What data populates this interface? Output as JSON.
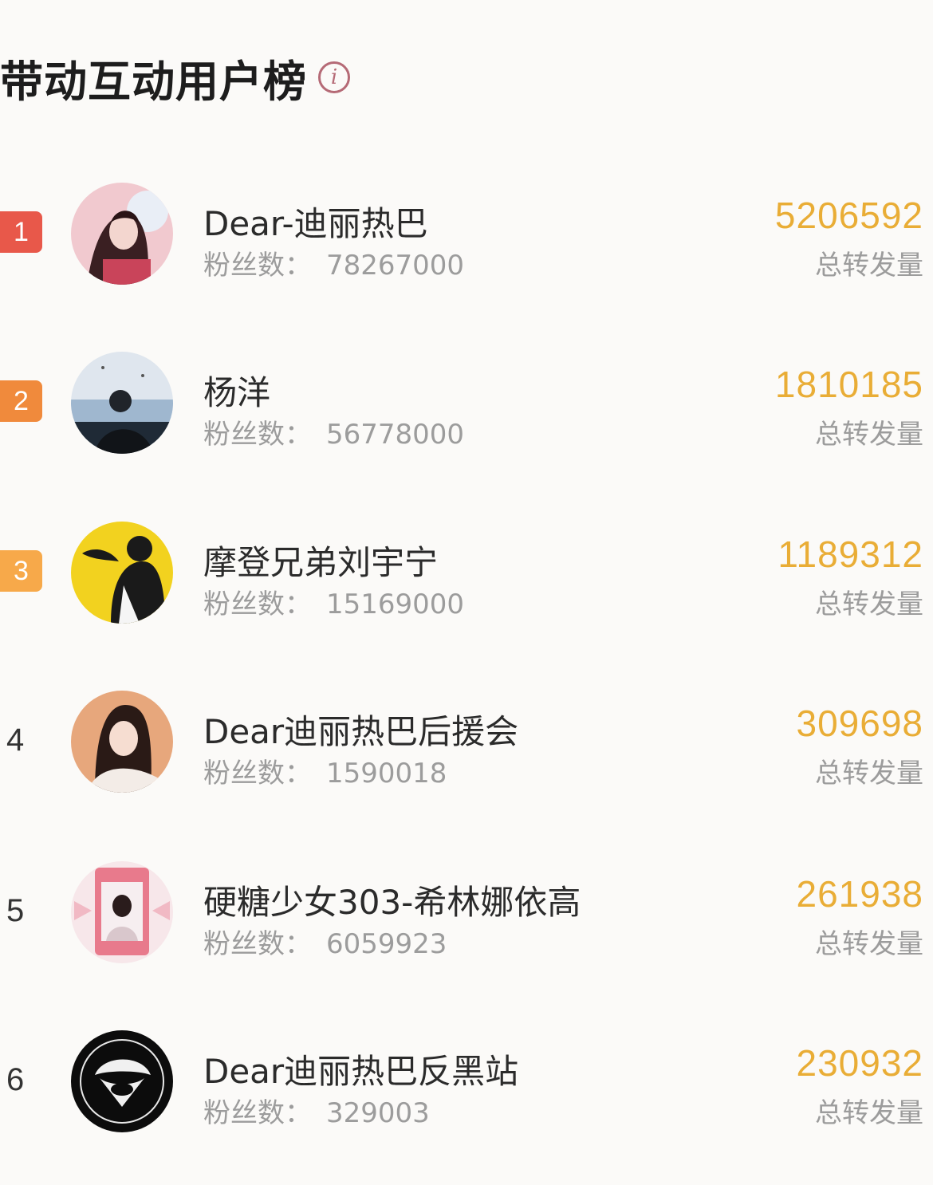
{
  "header": {
    "title": "带动互动用户榜",
    "info_icon": "info-icon"
  },
  "colors": {
    "rank1": "#e8584a",
    "rank2": "#f08a3c",
    "rank3": "#f7a94a",
    "count": "#e9ad36"
  },
  "fans_label": "粉丝数：",
  "users": [
    {
      "rank": "1",
      "name": "Dear-迪丽热巴",
      "fans": "78267000",
      "count": "5206592",
      "count_label": "总转发量"
    },
    {
      "rank": "2",
      "name": "杨洋",
      "fans": "56778000",
      "count": "1810185",
      "count_label": "总转发量"
    },
    {
      "rank": "3",
      "name": "摩登兄弟刘宇宁",
      "fans": "15169000",
      "count": "1189312",
      "count_label": "总转发量"
    },
    {
      "rank": "4",
      "name": "Dear迪丽热巴后援会",
      "fans": "1590018",
      "count": "309698",
      "count_label": "总转发量"
    },
    {
      "rank": "5",
      "name": "硬糖少女303-希林娜依高",
      "fans": "6059923",
      "count": "261938",
      "count_label": "总转发量"
    },
    {
      "rank": "6",
      "name": "Dear迪丽热巴反黑站",
      "fans": "329003",
      "count": "230932",
      "count_label": "总转发量"
    }
  ]
}
